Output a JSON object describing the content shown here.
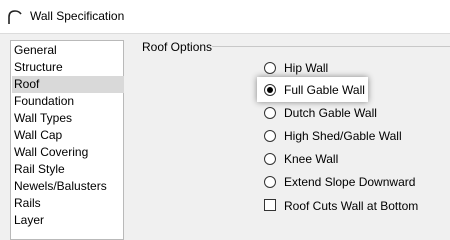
{
  "window": {
    "title": "Wall Specification"
  },
  "sidebar": {
    "items": [
      {
        "label": "General"
      },
      {
        "label": "Structure"
      },
      {
        "label": "Roof"
      },
      {
        "label": "Foundation"
      },
      {
        "label": "Wall Types"
      },
      {
        "label": "Wall Cap"
      },
      {
        "label": "Wall Covering"
      },
      {
        "label": "Rail Style"
      },
      {
        "label": "Newels/Balusters"
      },
      {
        "label": "Rails"
      },
      {
        "label": "Layer"
      }
    ],
    "selected": "Roof"
  },
  "roof_options": {
    "group_label": "Roof Options",
    "options": [
      {
        "label": "Hip Wall",
        "selected": false
      },
      {
        "label": "Full Gable Wall",
        "selected": true
      },
      {
        "label": "Dutch Gable Wall",
        "selected": false
      },
      {
        "label": "High Shed/Gable Wall",
        "selected": false
      },
      {
        "label": "Knee Wall",
        "selected": false
      },
      {
        "label": "Extend Slope Downward",
        "selected": false
      }
    ],
    "checkbox": {
      "label": "Roof Cuts Wall at Bottom",
      "checked": false
    }
  }
}
